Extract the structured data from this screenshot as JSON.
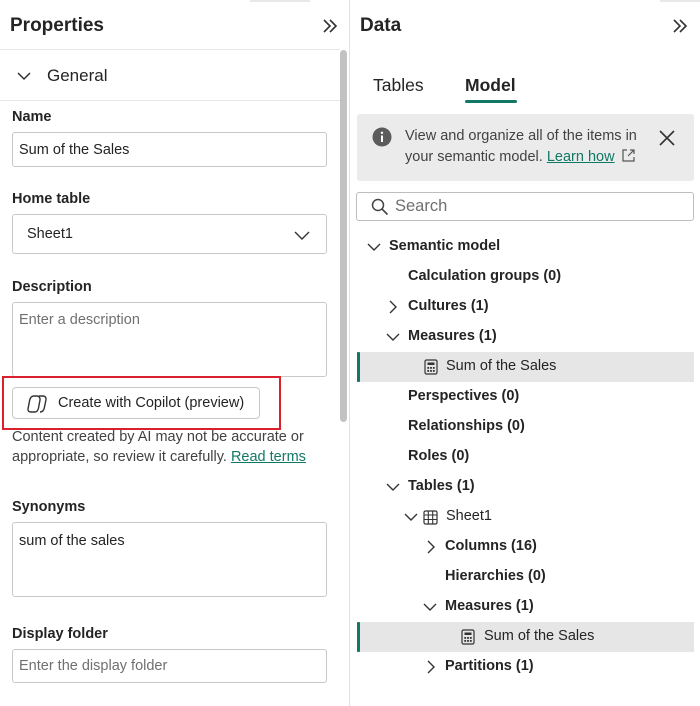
{
  "properties": {
    "title": "Properties",
    "section": "General",
    "name": {
      "label": "Name",
      "value": "Sum of the Sales"
    },
    "home_table": {
      "label": "Home table",
      "value": "Sheet1"
    },
    "description": {
      "label": "Description",
      "placeholder": "Enter a description"
    },
    "copilot_button": "Create with Copilot (preview)",
    "disclaimer_line1": "Content created by AI may not be accurate or",
    "disclaimer_line2": "appropriate, so review it carefully.",
    "read_terms": "Read terms",
    "synonyms": {
      "label": "Synonyms",
      "value": "sum of the sales"
    },
    "display_folder": {
      "label": "Display folder",
      "placeholder": "Enter the display folder"
    }
  },
  "data": {
    "title": "Data",
    "tabs": [
      "Tables",
      "Model"
    ],
    "active_tab": "Model",
    "info": {
      "line1": "View and organize all of the items in",
      "line2": "your semantic model.",
      "link": "Learn how"
    },
    "search_placeholder": "Search",
    "tree": [
      {
        "label": "Semantic model",
        "bold": true
      },
      {
        "label": "Calculation groups (0)",
        "bold": true
      },
      {
        "label": "Cultures (1)",
        "bold": true
      },
      {
        "label": "Measures (1)",
        "bold": true
      },
      {
        "label": "Sum of the Sales",
        "bold": false,
        "selected": true
      },
      {
        "label": "Perspectives (0)",
        "bold": true
      },
      {
        "label": "Relationships (0)",
        "bold": true
      },
      {
        "label": "Roles (0)",
        "bold": true
      },
      {
        "label": "Tables (1)",
        "bold": true
      },
      {
        "label": "Sheet1",
        "bold": false
      },
      {
        "label": "Columns (16)",
        "bold": true
      },
      {
        "label": "Hierarchies (0)",
        "bold": true
      },
      {
        "label": "Measures (1)",
        "bold": true
      },
      {
        "label": "Sum of the Sales",
        "bold": false,
        "selected": true
      },
      {
        "label": "Partitions (1)",
        "bold": true
      }
    ]
  },
  "colors": {
    "accent": "#117865",
    "highlight_border": "#d9202b",
    "selection": "#e6e6e6",
    "info_bg": "#ebebeb"
  },
  "icons": [
    "double-chevron-right-icon",
    "chevron-down-icon",
    "chevron-right-icon",
    "copilot-icon",
    "info-icon",
    "close-icon",
    "external-link-icon",
    "search-icon",
    "calculator-icon",
    "table-grid-icon"
  ]
}
